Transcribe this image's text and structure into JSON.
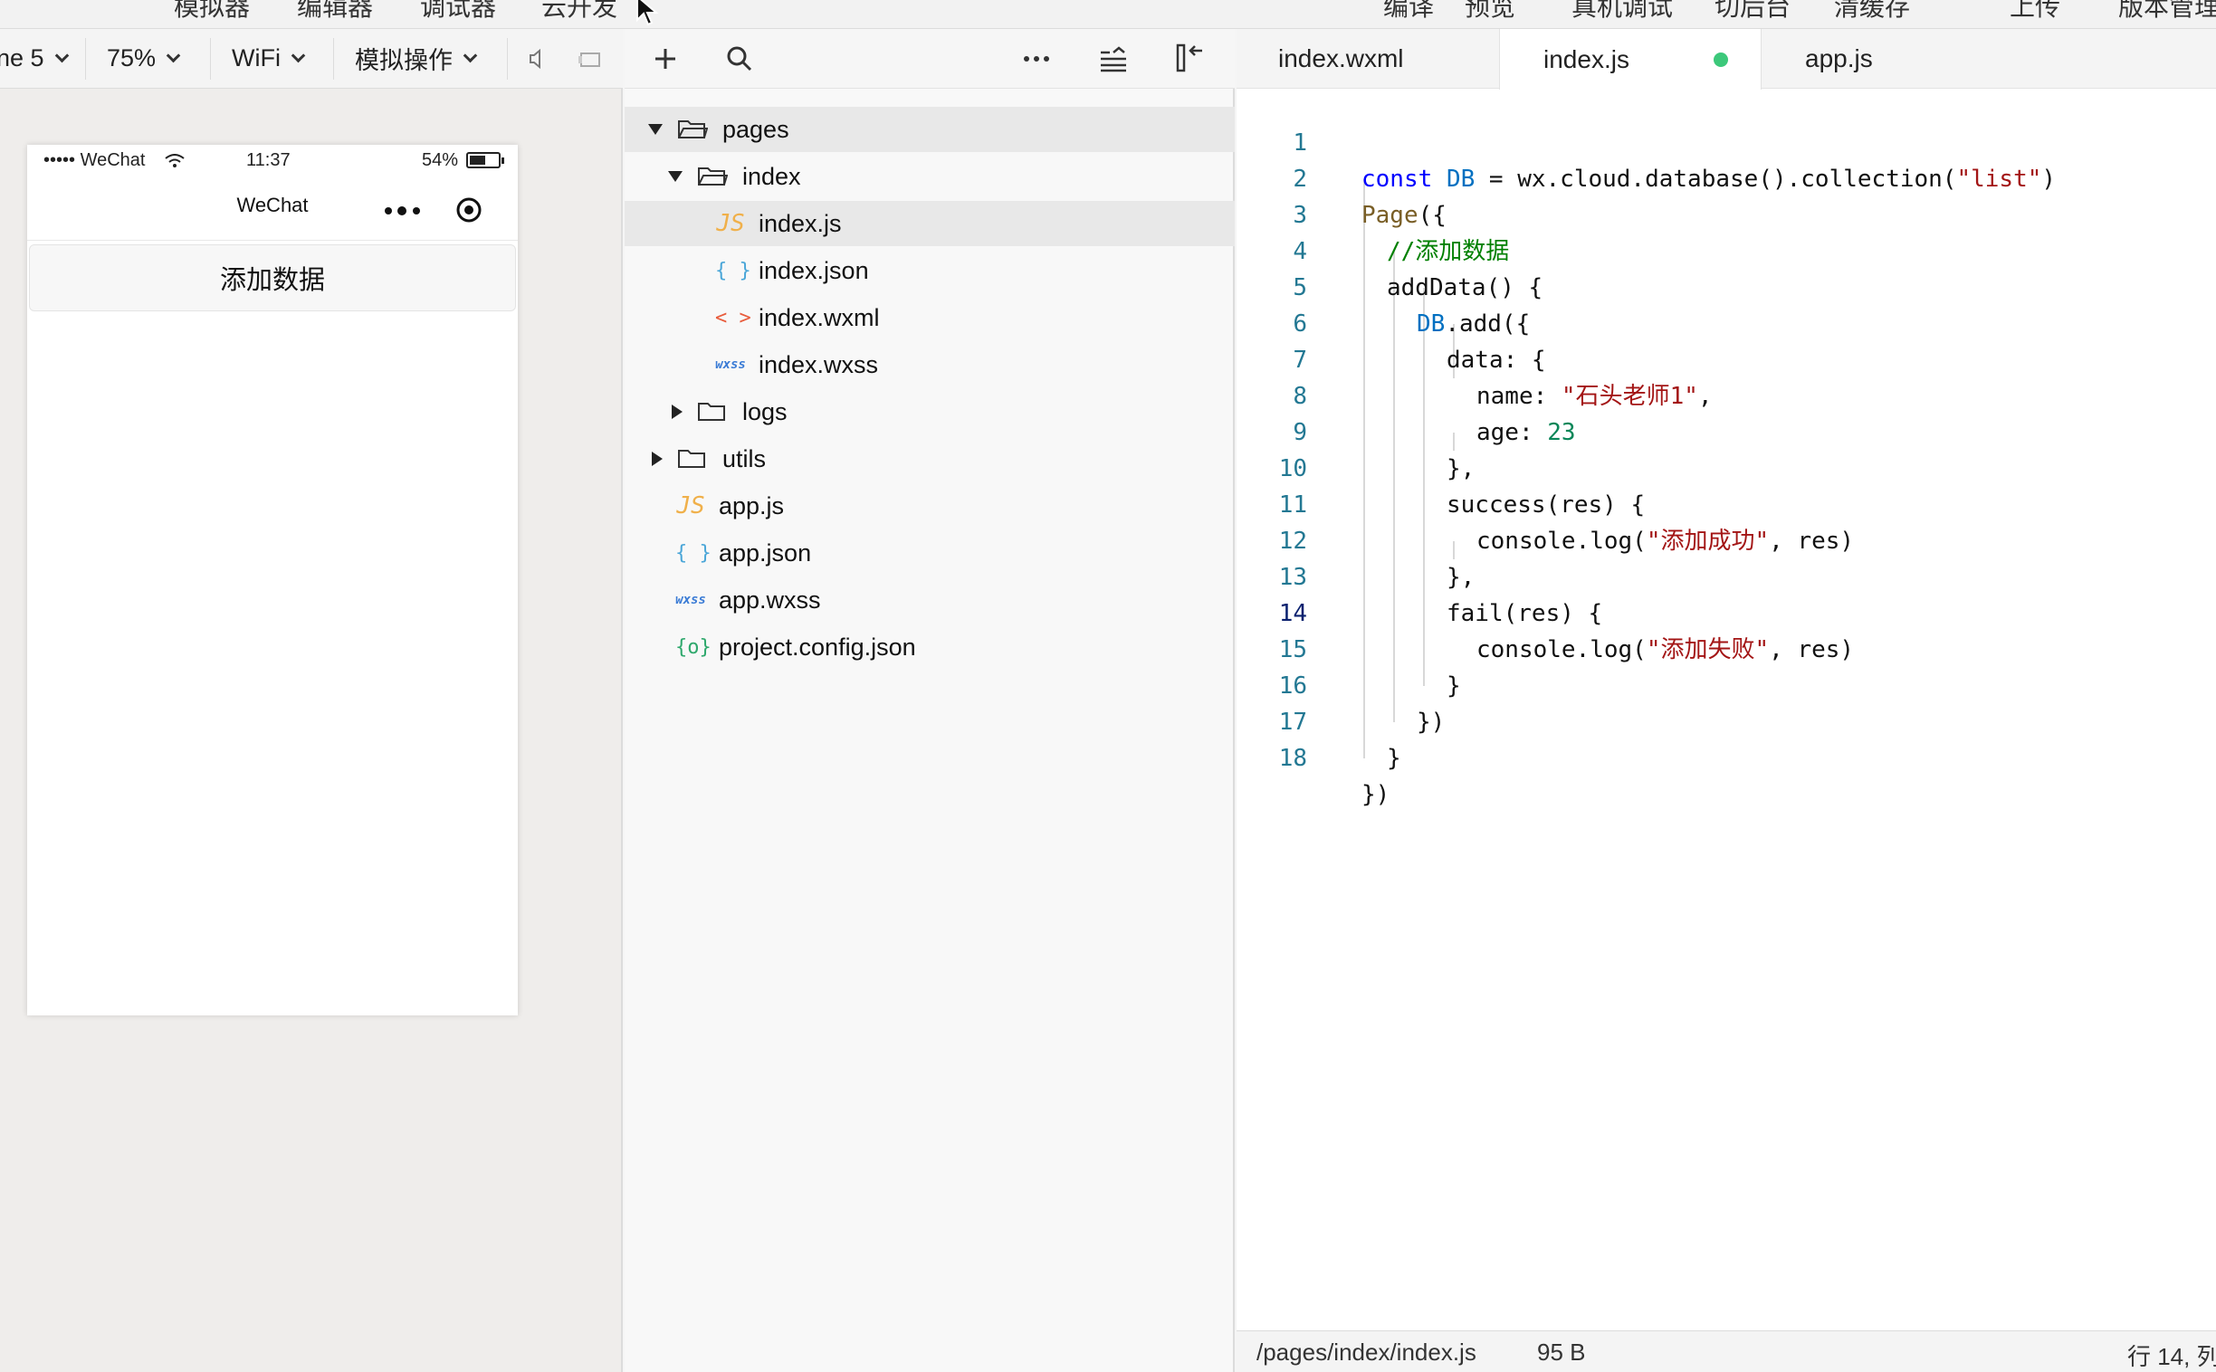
{
  "menu": {
    "left_items": [
      "模拟器",
      "编辑器",
      "调试器",
      "云开发"
    ],
    "right_items": [
      "编译",
      "预览",
      "真机调试",
      "切后台",
      "清缓存",
      "上传",
      "版本管理"
    ]
  },
  "simulator": {
    "device": "ne 5",
    "zoom": "75%",
    "network": "WiFi",
    "operate": "模拟操作",
    "phone": {
      "carrier": "••••• WeChat",
      "time": "11:37",
      "battery": "54%",
      "battery_level": 0.54,
      "nav_title": "WeChat",
      "button_label": "添加数据"
    }
  },
  "file_tree": {
    "folders": {
      "pages": "pages",
      "index": "index",
      "logs": "logs",
      "utils": "utils"
    },
    "files": {
      "index_js": "index.js",
      "index_json": "index.json",
      "index_wxml": "index.wxml",
      "index_wxss": "index.wxss",
      "app_js": "app.js",
      "app_json": "app.json",
      "app_wxss": "app.wxss",
      "project_config": "project.config.json"
    },
    "icons": {
      "js": "JS",
      "json": "{ }",
      "wxml": "< >",
      "wxss": "wxss",
      "config": "{o}"
    }
  },
  "editor": {
    "tabs": [
      "index.wxml",
      "index.js",
      "app.js"
    ],
    "active_tab": "index.js",
    "line_numbers": [
      "1",
      "2",
      "3",
      "4",
      "5",
      "6",
      "7",
      "8",
      "9",
      "10",
      "11",
      "12",
      "13",
      "14",
      "15",
      "16",
      "17",
      "18"
    ],
    "current_line": 14,
    "code": {
      "l1": {
        "kw": "const",
        "var": "DB",
        "rest": " = wx.cloud.database().collection(",
        "str": "\"list\"",
        "end": ")"
      },
      "l2": {
        "fn": "Page",
        "rest": "({"
      },
      "l3": {
        "comment": "//添加数据"
      },
      "l4": {
        "text": "addData() {"
      },
      "l5": {
        "var": "DB",
        "rest": ".add({"
      },
      "l6": {
        "text": "data: {"
      },
      "l7": {
        "key": "name: ",
        "str": "\"石头老师1\"",
        "end": ","
      },
      "l8": {
        "key": "age: ",
        "num": "23"
      },
      "l9": {
        "text": "},"
      },
      "l10": {
        "text": "success(res) {"
      },
      "l11": {
        "pre": "console.log(",
        "str": "\"添加成功\"",
        "end": ", res)"
      },
      "l12": {
        "text": "},"
      },
      "l13": {
        "text": "fail(res) {"
      },
      "l14": {
        "pre": "console.log(",
        "str": "\"添加失败\"",
        "end": ", res)"
      },
      "l15": {
        "text": "}"
      },
      "l16": {
        "text": "})"
      },
      "l17": {
        "text": "}"
      },
      "l18": {
        "text": "})"
      }
    }
  },
  "status": {
    "path": "/pages/index/index.js",
    "size": "95 B",
    "position": "行 14, 列"
  },
  "colors": {
    "dirty_dot": "#3cc87a",
    "keyword": "#0000ff",
    "string": "#a31515",
    "comment": "#008000"
  }
}
